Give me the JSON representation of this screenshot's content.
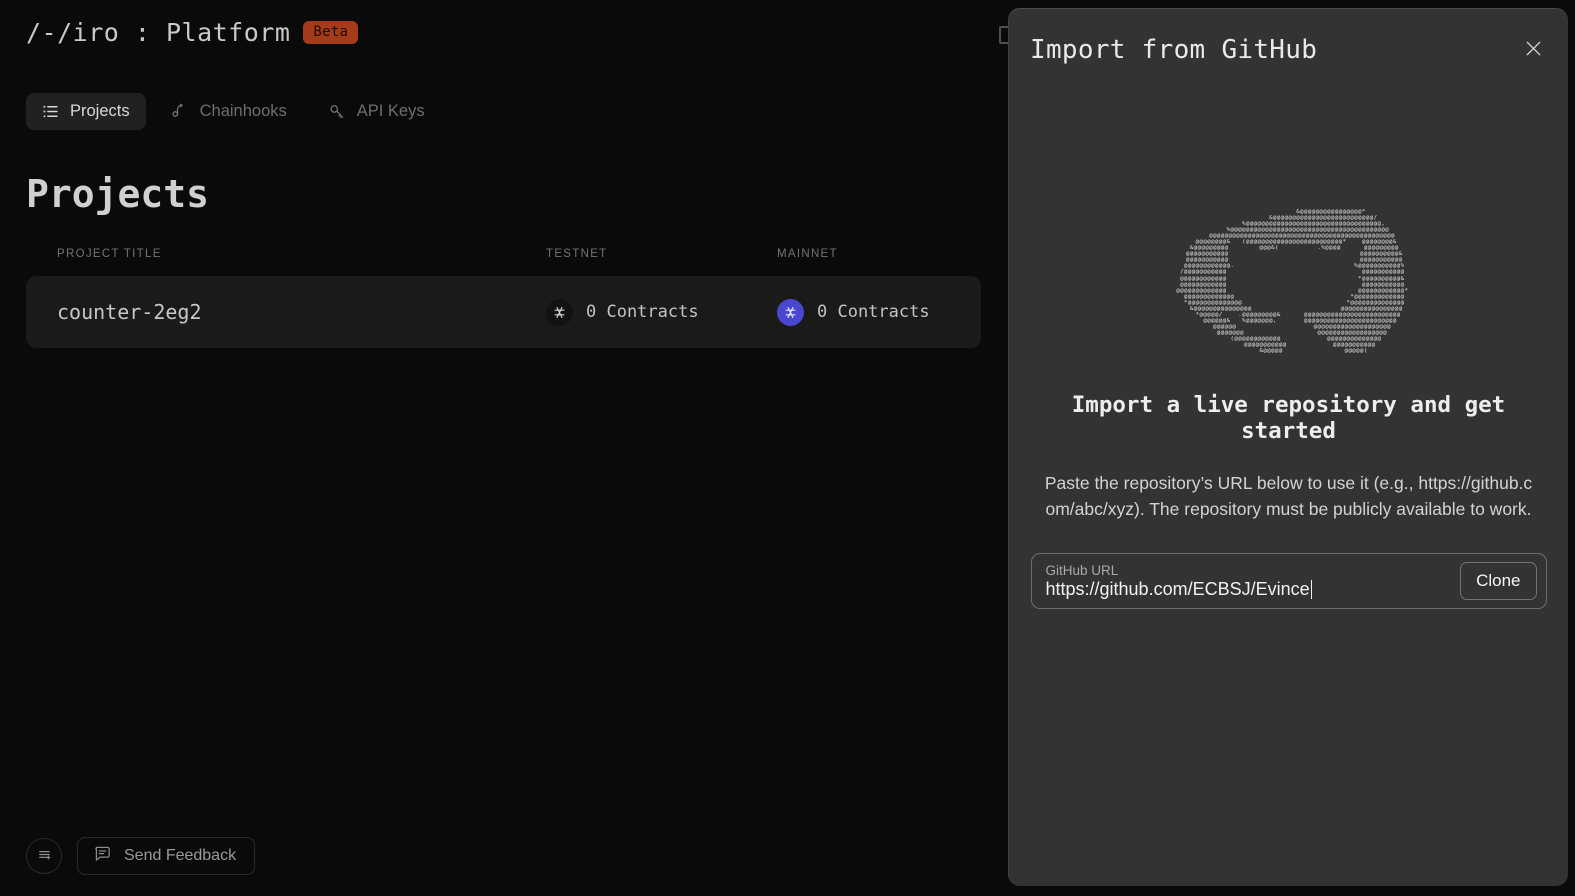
{
  "app": {
    "brand_title": "/-/iro : Platform",
    "beta_label": "Beta"
  },
  "nav": {
    "tabs": [
      {
        "label": "Projects",
        "icon": "list-icon",
        "active": true
      },
      {
        "label": "Chainhooks",
        "icon": "hook-icon",
        "active": false
      },
      {
        "label": "API Keys",
        "icon": "key-icon",
        "active": false
      }
    ]
  },
  "page": {
    "title": "Projects"
  },
  "table": {
    "columns": [
      "PROJECT TITLE",
      "TESTNET",
      "MAINNET"
    ],
    "rows": [
      {
        "title": "counter-2eg2",
        "testnet_count": "0 Contracts",
        "mainnet_count": "0 Contracts"
      }
    ]
  },
  "footer": {
    "menu_icon": "lines-plus-icon",
    "feedback_label": "Send Feedback",
    "feedback_icon": "speech-bubble-icon"
  },
  "modal": {
    "title": "Import from GitHub",
    "close_icon": "close-icon",
    "heading": "Import a live repository and get started",
    "description": "Paste the repository’s URL below to use it (e.g., https://github.c om/abc/xyz). The repository must be publicly available to work.",
    "ascii_art_name": "github-octocat-ascii-art",
    "ascii_art": "                      &@@@@@@@@@@@@@@@@*\n                  &@@@@@@@@@@@@@@@@@@@@@@@@@@/\n             %@@@@@@@@@@@@@@@@@@@@@@@@@@@@@@@@@@@,\n          %@@@@@@@@@@@@@@@@@@@@@@@@@@@@@@@@@@@@@@@@@\n       @@@@@@@@@@@@@@@@@@@@@@@@@@@@@@@@@@@@@@@@@@@@@@@@\n    @@@@@@@@&   (@@@@@@@@@@@@@@@@@@@@@@@@@*    @@@@@@@@&\n   &@@@@@@@@@        @@@&(          .%@@@@      @@@@@@@@@\n   @@@@@@@@@@@                                  @@@@@@@@@@&\n   @@@@@@@@@@@                                  @@@@@@@@@@@\n   @@@@@@@@@@@@.                               %@@@@@@@@@@@%\n  /@@@@@@@@@@@                                   @@@@@@@@@@@\n  @@@@@@@@@@@@                                  *@@@@@@@@@@&\n  @@@@@@@@@@@@                                   @@@@@@@@@@@\n  @@@@@@@@@@@@@                                  @@@@@@@@@@@@*\n   @@@@@@@@@@@@@                              *@@@@@@@@@@@@@\n   *@@@@@@@@@@@@@@                           *@@@@@@@@@@@@@@\n    &@@@@@@@@@@@@@@@                       @@@@@@@@@@@@@@@@\n     *@@@@@/    .@@@@@@@@@&      @@@@@@@@@@@@@@@@@@@@@@@@@\n      @@@@@@&   %@@@@@@@,       @@@@@@@@@@@@@@@@@@@@@@@@\n       @@@@@@                    @@@@@@@@@@@@@@@@@@@@\n       @@@@@@@                   @@@@@@@@@@@@@@@@@@\n         (@@@@@@@@@@@@            @@@@@@@@@@@@@@\n           @@@@@@@@@@@            @@@@@@@@@@@\n             &@@@@@                @@@@@(",
    "url_input": {
      "label": "GitHub URL",
      "value": "https://github.com/ECBSJ/Evince"
    },
    "clone_label": "Clone"
  },
  "colors": {
    "page_bg": "#0a0a0a",
    "modal_bg": "#333332",
    "beta_badge": "#a53b19",
    "mainnet_badge": "#4a46d0",
    "row_bg": "#1a1a19"
  }
}
